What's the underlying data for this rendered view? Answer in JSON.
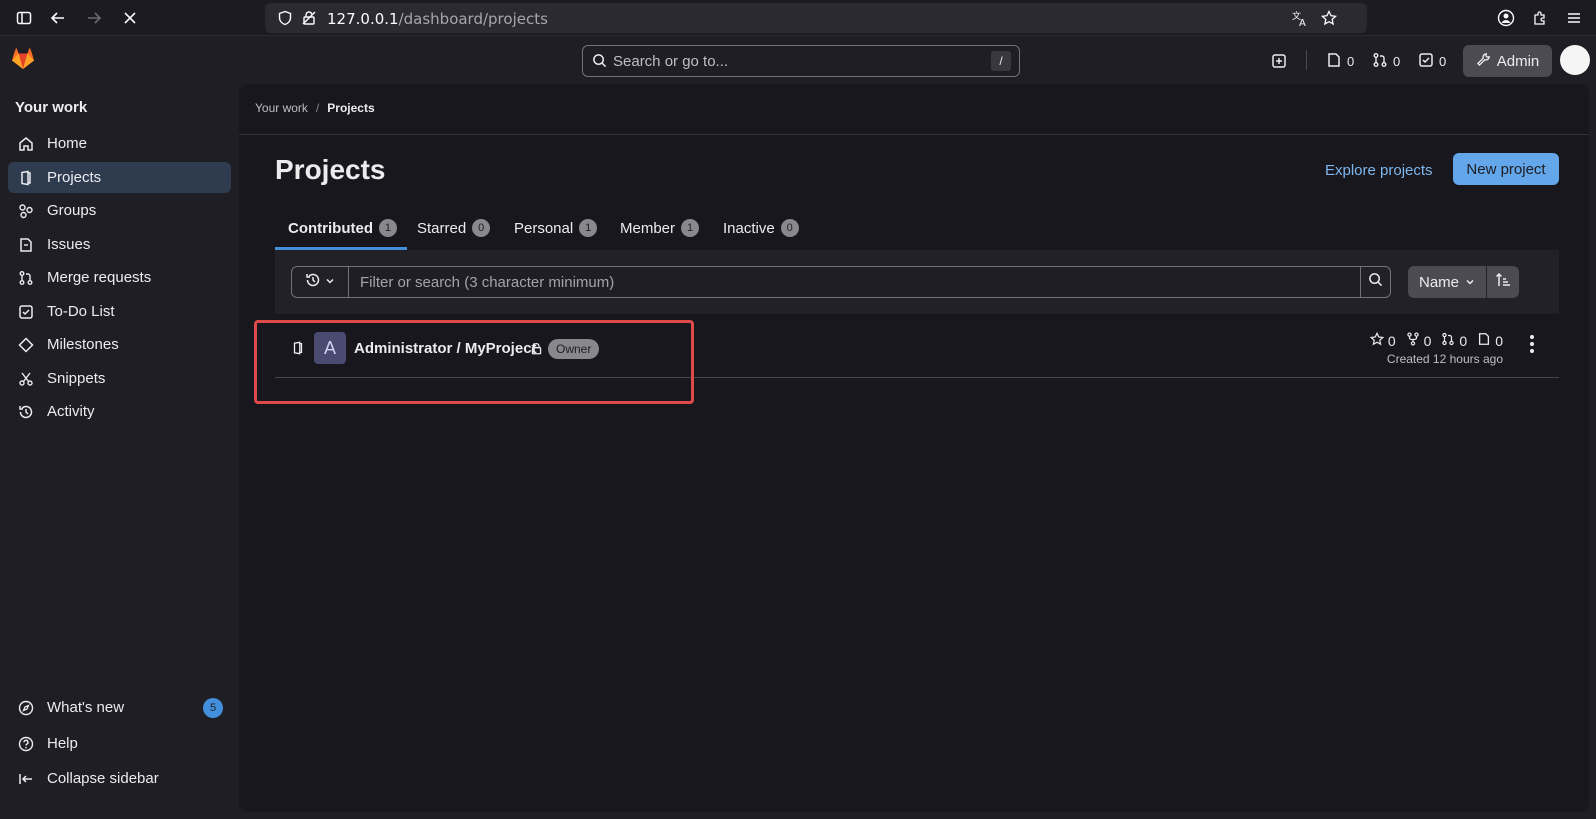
{
  "browser": {
    "url_host": "127.0.0.1",
    "url_path": "/dashboard/projects"
  },
  "topbar": {
    "search_placeholder": "Search or go to...",
    "search_shortcut": "/",
    "issues_count": "0",
    "mr_count": "0",
    "todo_count": "0",
    "admin_label": "Admin"
  },
  "sidebar": {
    "title": "Your work",
    "items": [
      {
        "label": "Home",
        "icon": "home-icon"
      },
      {
        "label": "Projects",
        "icon": "project-icon",
        "active": true
      },
      {
        "label": "Groups",
        "icon": "group-icon"
      },
      {
        "label": "Issues",
        "icon": "issues-icon"
      },
      {
        "label": "Merge requests",
        "icon": "merge-request-icon"
      },
      {
        "label": "To-Do List",
        "icon": "todo-icon"
      },
      {
        "label": "Milestones",
        "icon": "milestone-icon"
      },
      {
        "label": "Snippets",
        "icon": "snippet-icon"
      },
      {
        "label": "Activity",
        "icon": "history-icon"
      }
    ],
    "bottom": {
      "whats_new": "What's new",
      "whats_new_count": "5",
      "help": "Help",
      "collapse": "Collapse sidebar"
    }
  },
  "breadcrumb": {
    "parent": "Your work",
    "separator": "/",
    "current": "Projects"
  },
  "page": {
    "title": "Projects",
    "explore_label": "Explore projects",
    "new_project_label": "New project"
  },
  "tabs": [
    {
      "label": "Contributed",
      "count": "1",
      "active": true
    },
    {
      "label": "Starred",
      "count": "0"
    },
    {
      "label": "Personal",
      "count": "1"
    },
    {
      "label": "Member",
      "count": "1"
    },
    {
      "label": "Inactive",
      "count": "0"
    }
  ],
  "filter": {
    "placeholder": "Filter or search (3 character minimum)",
    "sort_label": "Name"
  },
  "project": {
    "avatar_letter": "A",
    "name": "Administrator / MyProject",
    "role": "Owner",
    "stars": "0",
    "forks": "0",
    "merge_requests": "0",
    "issues": "0",
    "created": "Created 12 hours ago"
  },
  "colors": {
    "accent": "#428fdc",
    "primary_button": "#63a6e9",
    "highlight": "#e04a4a",
    "logo": "#fc6d26"
  }
}
